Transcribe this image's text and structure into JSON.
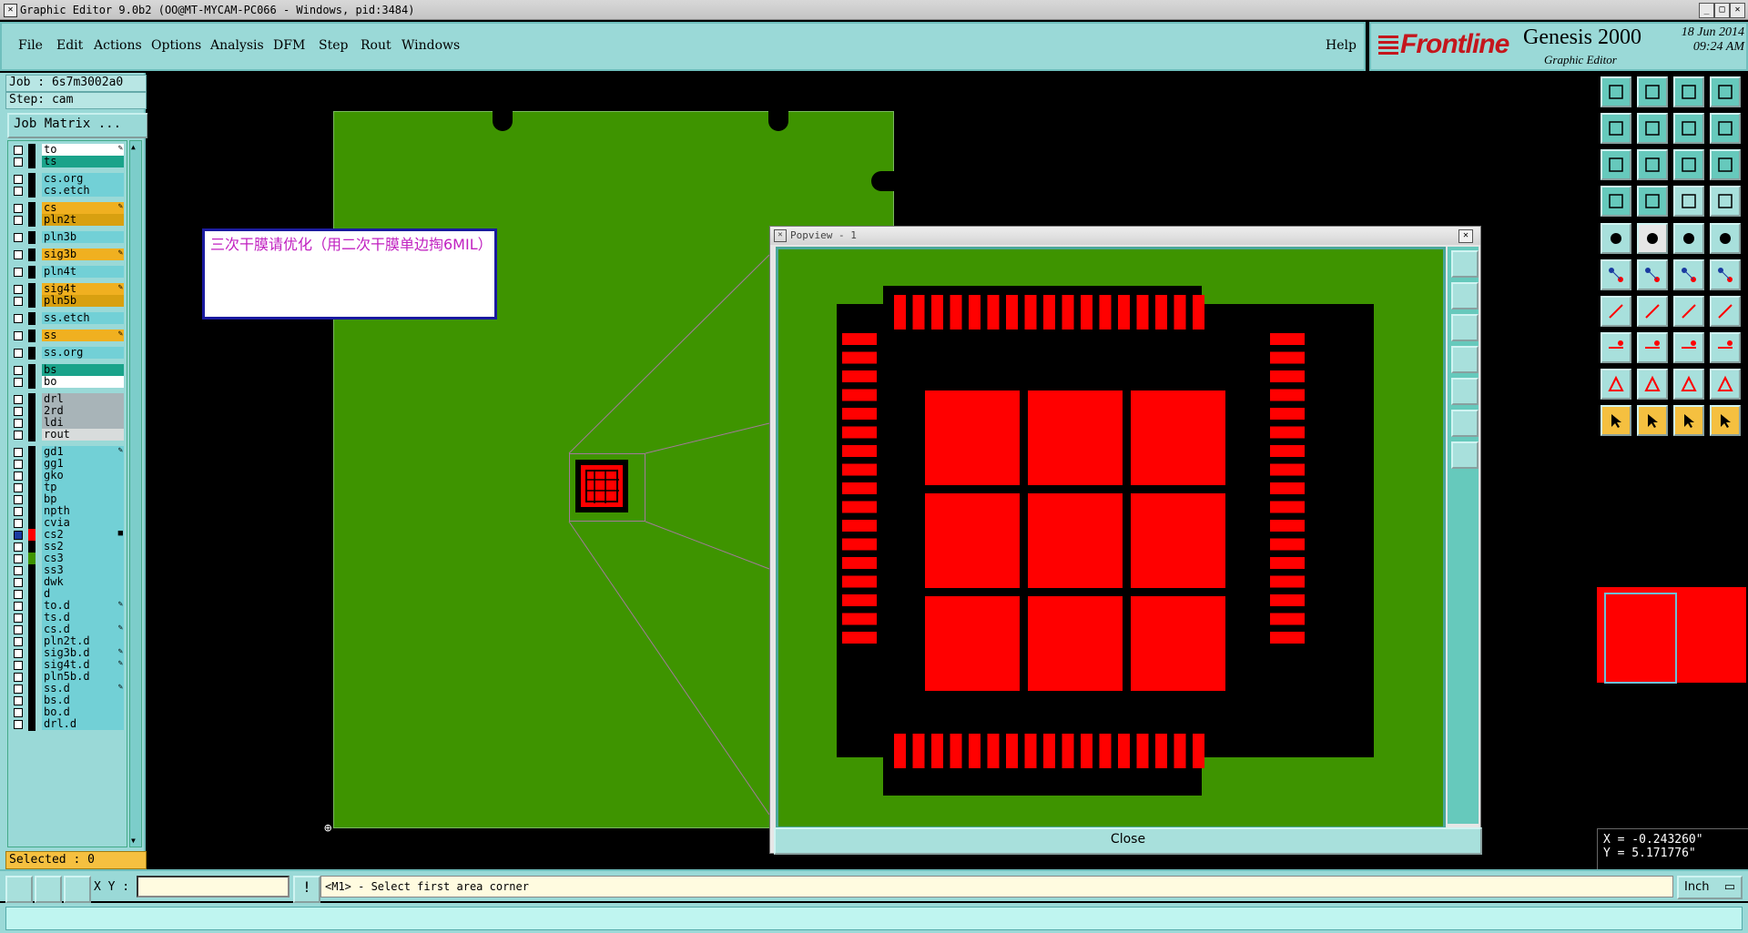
{
  "window": {
    "title": "Graphic Editor 9.0b2 (OO@MT-MYCAM-PC066 - Windows, pid:3484)"
  },
  "menu": {
    "file": "File",
    "edit": "Edit",
    "actions": "Actions",
    "options": "Options",
    "analysis": "Analysis",
    "dfm": "DFM",
    "step": "Step",
    "rout": "Rout",
    "windows": "Windows",
    "help": "Help"
  },
  "brand": {
    "logo": "Frontline",
    "product": "Genesis 2000",
    "subtitle": "Graphic Editor",
    "date": "18 Jun 2014",
    "time": "09:24 AM"
  },
  "job": {
    "job_label": "Job : 6s7m3002a0",
    "step_label": "Step: cam",
    "matrix_button": "Job Matrix ..."
  },
  "layers": [
    {
      "name": "to",
      "color": "#ffffff",
      "mark": "✎"
    },
    {
      "name": "ts",
      "color": "#1aa38a",
      "mark": ""
    },
    {
      "name": "cs.org",
      "color": "#72d0d6",
      "mark": ""
    },
    {
      "name": "cs.etch",
      "color": "#72d0d6",
      "mark": ""
    },
    {
      "name": "cs",
      "color": "#f0b020",
      "mark": "✎"
    },
    {
      "name": "pln2t",
      "color": "#d8a010",
      "mark": ""
    },
    {
      "name": "pln3b",
      "color": "#72d0d6",
      "mark": ""
    },
    {
      "name": "sig3b",
      "color": "#f0b020",
      "mark": "✎"
    },
    {
      "name": "pln4t",
      "color": "#72d0d6",
      "mark": ""
    },
    {
      "name": "sig4t",
      "color": "#f0b020",
      "mark": "✎"
    },
    {
      "name": "pln5b",
      "color": "#d8a010",
      "mark": ""
    },
    {
      "name": "ss.etch",
      "color": "#72d0d6",
      "mark": ""
    },
    {
      "name": "ss",
      "color": "#f0b020",
      "mark": "✎"
    },
    {
      "name": "ss.org",
      "color": "#72d0d6",
      "mark": ""
    },
    {
      "name": "bs",
      "color": "#1aa38a",
      "mark": ""
    },
    {
      "name": "bo",
      "color": "#ffffff",
      "mark": ""
    },
    {
      "name": "drl",
      "color": "#a8b4b8",
      "mark": ""
    },
    {
      "name": "2rd",
      "color": "#a8b4b8",
      "mark": ""
    },
    {
      "name": "ldi",
      "color": "#a8b4b8",
      "mark": ""
    },
    {
      "name": "rout",
      "color": "#d8dcdc",
      "mark": ""
    },
    {
      "name": "gd1",
      "color": "#72d0d6",
      "mark": "✎"
    },
    {
      "name": "gg1",
      "color": "#72d0d6",
      "mark": ""
    },
    {
      "name": "gko",
      "color": "#72d0d6",
      "mark": ""
    },
    {
      "name": "tp",
      "color": "#72d0d6",
      "mark": ""
    },
    {
      "name": "bp",
      "color": "#72d0d6",
      "mark": ""
    },
    {
      "name": "npth",
      "color": "#72d0d6",
      "mark": ""
    },
    {
      "name": "cvia",
      "color": "#72d0d6",
      "mark": ""
    },
    {
      "name": "cs2",
      "color": "#72d0d6",
      "mark": "■"
    },
    {
      "name": "ss2",
      "color": "#72d0d6",
      "mark": ""
    },
    {
      "name": "cs3",
      "color": "#72d0d6",
      "mark": ""
    },
    {
      "name": "ss3",
      "color": "#72d0d6",
      "mark": ""
    },
    {
      "name": "dwk",
      "color": "#72d0d6",
      "mark": ""
    },
    {
      "name": "d",
      "color": "#72d0d6",
      "mark": ""
    },
    {
      "name": "to.d",
      "color": "#72d0d6",
      "mark": "✎"
    },
    {
      "name": "ts.d",
      "color": "#72d0d6",
      "mark": ""
    },
    {
      "name": "cs.d",
      "color": "#72d0d6",
      "mark": "✎"
    },
    {
      "name": "pln2t.d",
      "color": "#72d0d6",
      "mark": ""
    },
    {
      "name": "sig3b.d",
      "color": "#72d0d6",
      "mark": "✎"
    },
    {
      "name": "sig4t.d",
      "color": "#72d0d6",
      "mark": "✎"
    },
    {
      "name": "pln5b.d",
      "color": "#72d0d6",
      "mark": ""
    },
    {
      "name": "ss.d",
      "color": "#72d0d6",
      "mark": "✎"
    },
    {
      "name": "bs.d",
      "color": "#72d0d6",
      "mark": ""
    },
    {
      "name": "bo.d",
      "color": "#72d0d6",
      "mark": ""
    },
    {
      "name": "drl.d",
      "color": "#72d0d6",
      "mark": ""
    }
  ],
  "selected": "Selected : 0",
  "note": {
    "text": "三次干膜请优化（用二次干膜单边掏6MIL）"
  },
  "popview": {
    "title": "Popview - 1",
    "close_label": "Close"
  },
  "coords": {
    "x": "X = -0.243260\"",
    "y": "Y = 5.171776\""
  },
  "status": {
    "xy_label": "X Y :",
    "xy_value": "",
    "prompt": "<M1> - Select first area corner",
    "units": "Inch"
  },
  "colors": {
    "panel": "#9ad9d7",
    "board": "#3e9400",
    "pad": "#ff0000",
    "highlight": "#f0b020"
  }
}
